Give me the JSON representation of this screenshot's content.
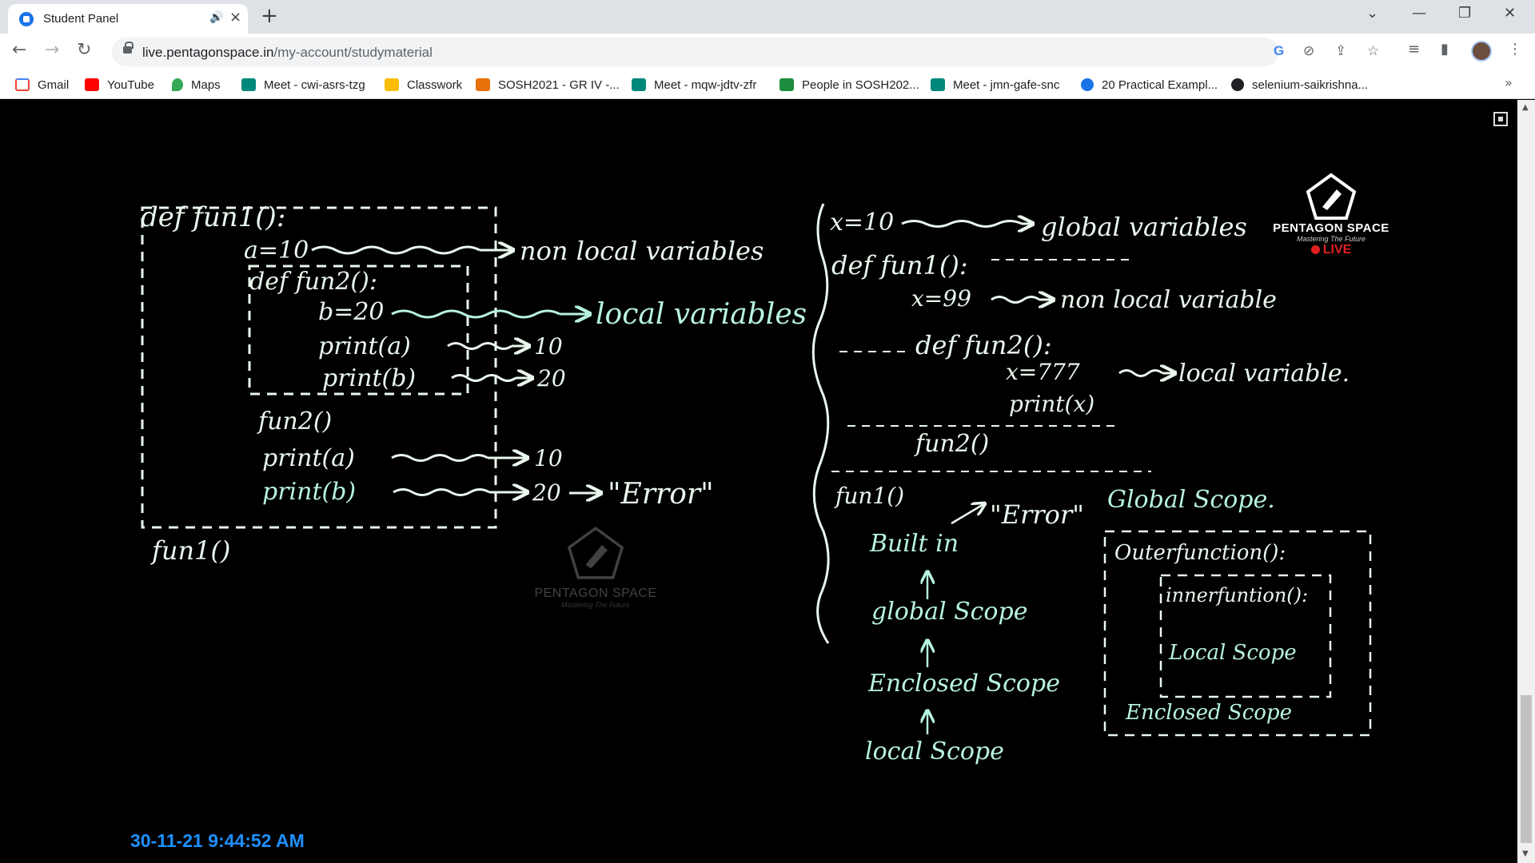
{
  "browser": {
    "tab": {
      "title": "Student Panel"
    },
    "window_controls": {
      "minimize": "—",
      "restore": "❐",
      "close": "✕"
    },
    "url": {
      "host": "live.pentagonspace.in",
      "path": "/my-account/studymaterial"
    },
    "bookmarks": [
      {
        "label": "Gmail",
        "icon": "gmail-icon",
        "color": "#ea4335"
      },
      {
        "label": "YouTube",
        "icon": "youtube-icon",
        "color": "#ff0000"
      },
      {
        "label": "Maps",
        "icon": "maps-icon",
        "color": "#34a853"
      },
      {
        "label": "Meet - cwi-asrs-tzg",
        "icon": "meet-icon",
        "color": "#00897b"
      },
      {
        "label": "Classwork",
        "icon": "classroom-icon",
        "color": "#fbbc04"
      },
      {
        "label": "SOSH2021 - GR IV -...",
        "icon": "orange-app-icon",
        "color": "#e8710a"
      },
      {
        "label": "Meet - mqw-jdtv-zfr",
        "icon": "meet-icon",
        "color": "#00897b"
      },
      {
        "label": "People in SOSH202...",
        "icon": "classroom-icon",
        "color": "#1e8e3e"
      },
      {
        "label": "Meet - jmn-gafe-snc",
        "icon": "meet-icon",
        "color": "#00897b"
      },
      {
        "label": "20 Practical Exampl...",
        "icon": "blue-site-icon",
        "color": "#1a73e8"
      },
      {
        "label": "selenium-saikrishna...",
        "icon": "github-icon",
        "color": "#202124"
      }
    ],
    "bookmarks_overflow": "»"
  },
  "board": {
    "left": {
      "l1": "def fun1():",
      "l2": "a=10",
      "l2_note": "non local variables",
      "l3": "def fun2():",
      "l4": "b=20",
      "l4_note": "local variables",
      "l5": "print(a)",
      "l5_out": "10",
      "l6": "print(b)",
      "l6_out": "20",
      "l7": "fun2()",
      "l8": "print(a)",
      "l8_out": "10",
      "l9": "print(b)",
      "l9_out": "20",
      "l9_err": "\"Error\"",
      "l10": "fun1()"
    },
    "right": {
      "r1": "x=10",
      "r1_note": "global variables",
      "r2": "def fun1():",
      "r3": "x=99",
      "r3_note": "non local variable",
      "r4": "def fun2():",
      "r5": "x=777",
      "r5_note": "local variable.",
      "r6": "print(x)",
      "r7": "fun2()",
      "r8": "fun1()",
      "r8_err": "\"Error\"",
      "scope1": "Built in",
      "scope2": "global Scope",
      "scope3": "Enclosed Scope",
      "scope4": "local Scope",
      "box_title": "Global Scope.",
      "outer_fn": "Outerfunction():",
      "inner_fn": "innerfuntion():",
      "inner_scope": "Local Scope",
      "outer_scope": "Enclosed Scope"
    }
  },
  "logo": {
    "name": "PENTAGON SPACE",
    "tagline": "Mastering The Future",
    "live": "LIVE"
  },
  "watermark": {
    "name": "PENTAGON SPACE",
    "tagline": "Mastering The Future"
  },
  "timestamp": "30-11-21 9:44:52 AM"
}
